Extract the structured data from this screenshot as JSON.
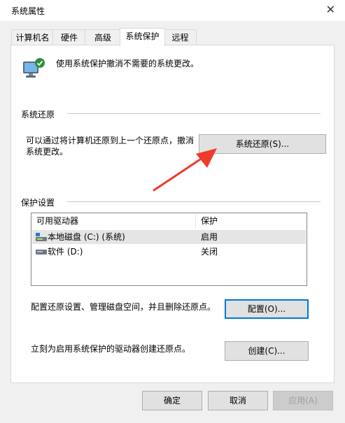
{
  "window": {
    "title": "系统属性",
    "close_glyph": "✕"
  },
  "tabs": [
    {
      "label": "计算机名"
    },
    {
      "label": "硬件"
    },
    {
      "label": "高级"
    },
    {
      "label": "系统保护"
    },
    {
      "label": "远程"
    }
  ],
  "intro": {
    "text": "使用系统保护撤消不需要的系统更改。",
    "icon": "computer-shield-icon"
  },
  "restore": {
    "group_label": "系统还原",
    "line1": "可以通过将计算机还原到上一个还原点，撤消",
    "line2": "系统更改。",
    "button_label": "系统还原(S)..."
  },
  "protection": {
    "group_label": "保护设置",
    "columns": [
      "可用驱动器",
      "保护"
    ],
    "rows": [
      {
        "drive": "本地磁盘 (C:) (系统)",
        "protection": "启用",
        "icon": "system-drive-icon"
      },
      {
        "drive": "软件 (D:)",
        "protection": "关闭",
        "icon": "drive-icon"
      }
    ],
    "configure_text": "配置还原设置、管理磁盘空间，并且删除还原点。",
    "configure_button": "配置(O)...",
    "create_text": "立刻为启用系统保护的驱动器创建还原点。",
    "create_button": "创建(C)..."
  },
  "footer": {
    "ok": "确定",
    "cancel": "取消",
    "apply": "应用(A)"
  },
  "colors": {
    "annotation_arrow": "#ee3b2b",
    "focus_border": "#0078d7"
  }
}
